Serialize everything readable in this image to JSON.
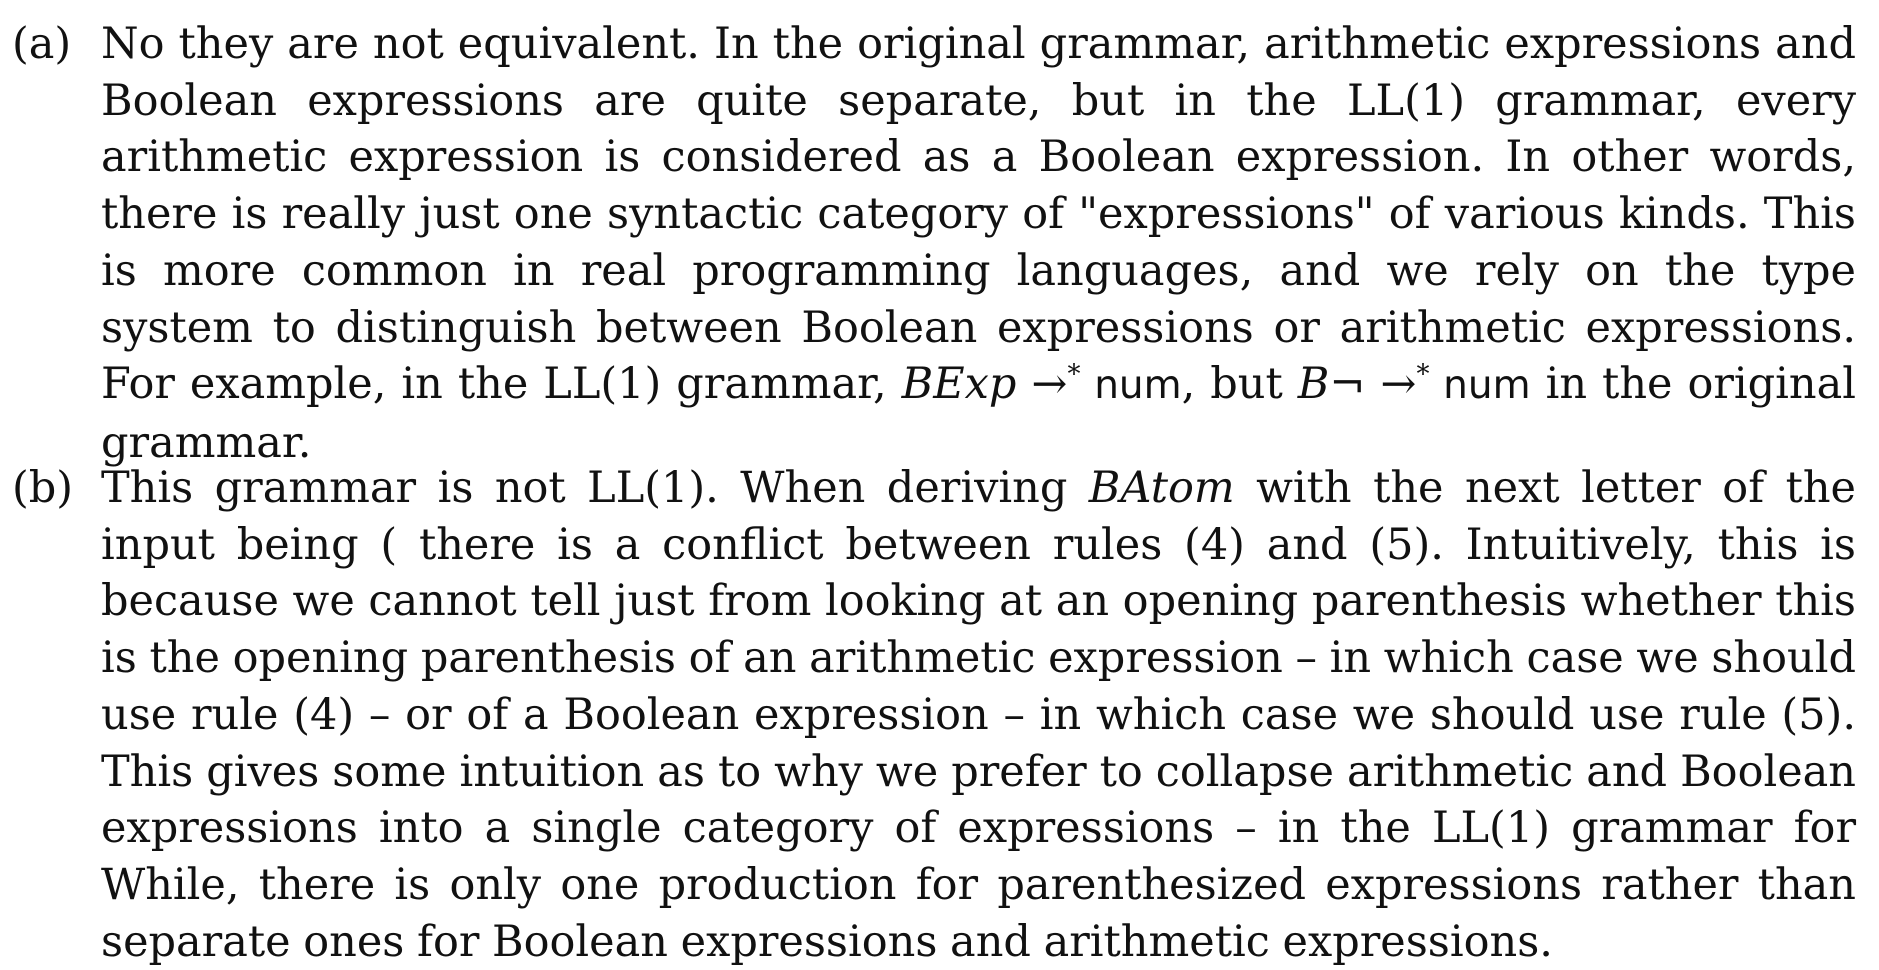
{
  "a": {
    "label": "(a)",
    "text1": "No they are not equivalent. In the original grammar, arithmetic expressions and Boolean expressions are quite separate, but in the LL(1) grammar, every arithmetic expression is considered as a Boolean expression. In other words, there is really just one syntactic category of \"expressions\" of various kinds. This is more common in real programming languages, and we rely on the type system to distinguish between Boolean expressions or arithmetic expressions. For example, in the LL(1) grammar, ",
    "math1": "BExp",
    "arrow1": " →",
    "star1": "*",
    "num1": " num",
    "text2": ", but ",
    "math2": "B¬",
    "arrow2": " →",
    "star2": "*",
    "num2": " num",
    "text3": " in the original grammar."
  },
  "b": {
    "label": "(b)",
    "text1": "This grammar is not LL(1). When deriving ",
    "math1": "BAtom",
    "text2": " with the next letter of the input being ( there is a conflict between rules (4) and (5). Intuitively, this is because we cannot tell just from looking at an opening parenthesis whether this is the opening parenthesis of an arithmetic expression – in which case we should use rule (4) – or of a Boolean expression – in which case we should use rule (5). This gives some intuition as to why we prefer to collapse arithmetic and Boolean expressions into a single category of expressions – in the LL(1) grammar for While, there is only one production for parenthesized expressions rather than separate ones for Boolean expressions and arithmetic expressions."
  }
}
